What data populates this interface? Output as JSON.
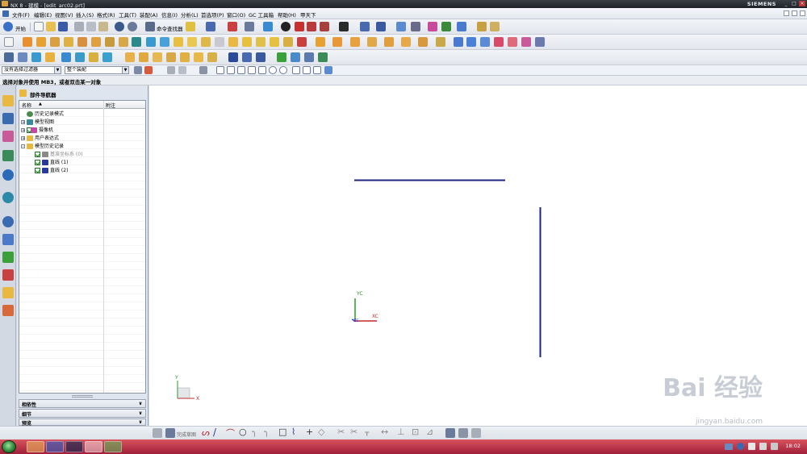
{
  "window": {
    "title": "NX 8 - 建模 - [edit_arc02.prt]",
    "brand": "SIEMENS",
    "controls": [
      "_",
      "□",
      "×"
    ]
  },
  "menubar": {
    "items": [
      "文件(F)",
      "编辑(E)",
      "视图(V)",
      "插入(S)",
      "格式(R)",
      "工具(T)",
      "装配(A)",
      "信息(I)",
      "分析(L)",
      "首选项(P)",
      "窗口(O)",
      "GC 工具箱",
      "帮助(H)",
      "甲天下"
    ]
  },
  "toolbar": {
    "start_label": "开始",
    "command_finder_label": "命令查找器"
  },
  "selection_bar": {
    "filter_value": "没有选择过滤器",
    "scope_value": "整个装配"
  },
  "cue_line": "选择对象并使用 MB3，或者双击某一对象",
  "navigator": {
    "title": "部件导航器",
    "columns": [
      "名称",
      "附注"
    ],
    "nodes": [
      {
        "label": "历史记录模式",
        "level": 0,
        "expander": "",
        "icon": "clock-icon",
        "color": "#4a8a4a",
        "check": false
      },
      {
        "label": "模型视图",
        "level": 0,
        "expander": "+",
        "icon": "views-icon",
        "color": "#3a8a9a",
        "check": false
      },
      {
        "label": "摄像机",
        "level": 0,
        "expander": "+",
        "icon": "camera-icon",
        "color": "#c04aa0",
        "check": true
      },
      {
        "label": "用户表达式",
        "level": 0,
        "expander": "+",
        "icon": "folder-icon",
        "color": "#e8b840",
        "check": false
      },
      {
        "label": "模型历史记录",
        "level": 0,
        "expander": "-",
        "icon": "folder-open-icon",
        "color": "#e8b840",
        "check": false
      },
      {
        "label": "基准坐标系 (0)",
        "level": 1,
        "expander": "",
        "icon": "datum-csys-icon",
        "color": "#8a8a8a",
        "check": true
      },
      {
        "label": "直线 (1)",
        "level": 1,
        "expander": "",
        "icon": "line-icon",
        "color": "#2a3a9a",
        "check": true
      },
      {
        "label": "直线 (2)",
        "level": 1,
        "expander": "",
        "icon": "line-icon",
        "color": "#2a3a9a",
        "check": true
      }
    ],
    "panels": [
      "相依性",
      "细节",
      "预览"
    ]
  },
  "viewport": {
    "wcs": {
      "yc": "YC",
      "xc": "XC",
      "zc": "ZC"
    },
    "corner_triad": {
      "x": "X",
      "y": "Y"
    },
    "line_color": "#1c2480"
  },
  "bottom_toolbar": {
    "finish_sketch_label": "完成草图"
  },
  "taskbar": {
    "clock": "18:02",
    "apps": [
      "folder-app",
      "word-app",
      "terminal-app",
      "nx-app",
      "chrome-app"
    ]
  },
  "watermark": {
    "text": "Bai 经验",
    "url": "jingyan.baidu.com"
  }
}
